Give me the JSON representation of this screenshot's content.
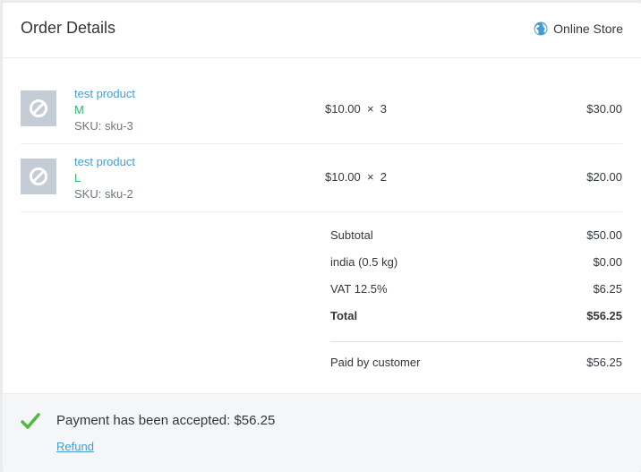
{
  "header": {
    "title": "Order Details",
    "source": "Online Store",
    "source_icon": "globe-icon"
  },
  "line_items": [
    {
      "name": "test product",
      "variant": "M",
      "sku": "SKU: sku-3",
      "price_qty": "$10.00  ×  3",
      "total": "$30.00",
      "image_icon": "no-image-icon"
    },
    {
      "name": "test product",
      "variant": "L",
      "sku": "SKU: sku-2",
      "price_qty": "$10.00  ×  2",
      "total": "$20.00",
      "image_icon": "no-image-icon"
    }
  ],
  "summary": {
    "rows": [
      {
        "label": "Subtotal",
        "value": "$50.00"
      },
      {
        "label": "india (0.5 kg)",
        "value": "$0.00"
      },
      {
        "label": "VAT 12.5%",
        "value": "$6.25"
      }
    ],
    "total": {
      "label": "Total",
      "value": "$56.25"
    },
    "paid": {
      "label": "Paid by customer",
      "value": "$56.25"
    }
  },
  "payment": {
    "status": "Payment has been accepted: $56.25",
    "refund_label": "Refund",
    "status_icon": "checkmark-icon",
    "accent": "#50b83c"
  },
  "colors": {
    "link": "#479ccf",
    "variant": "#32b66c"
  }
}
